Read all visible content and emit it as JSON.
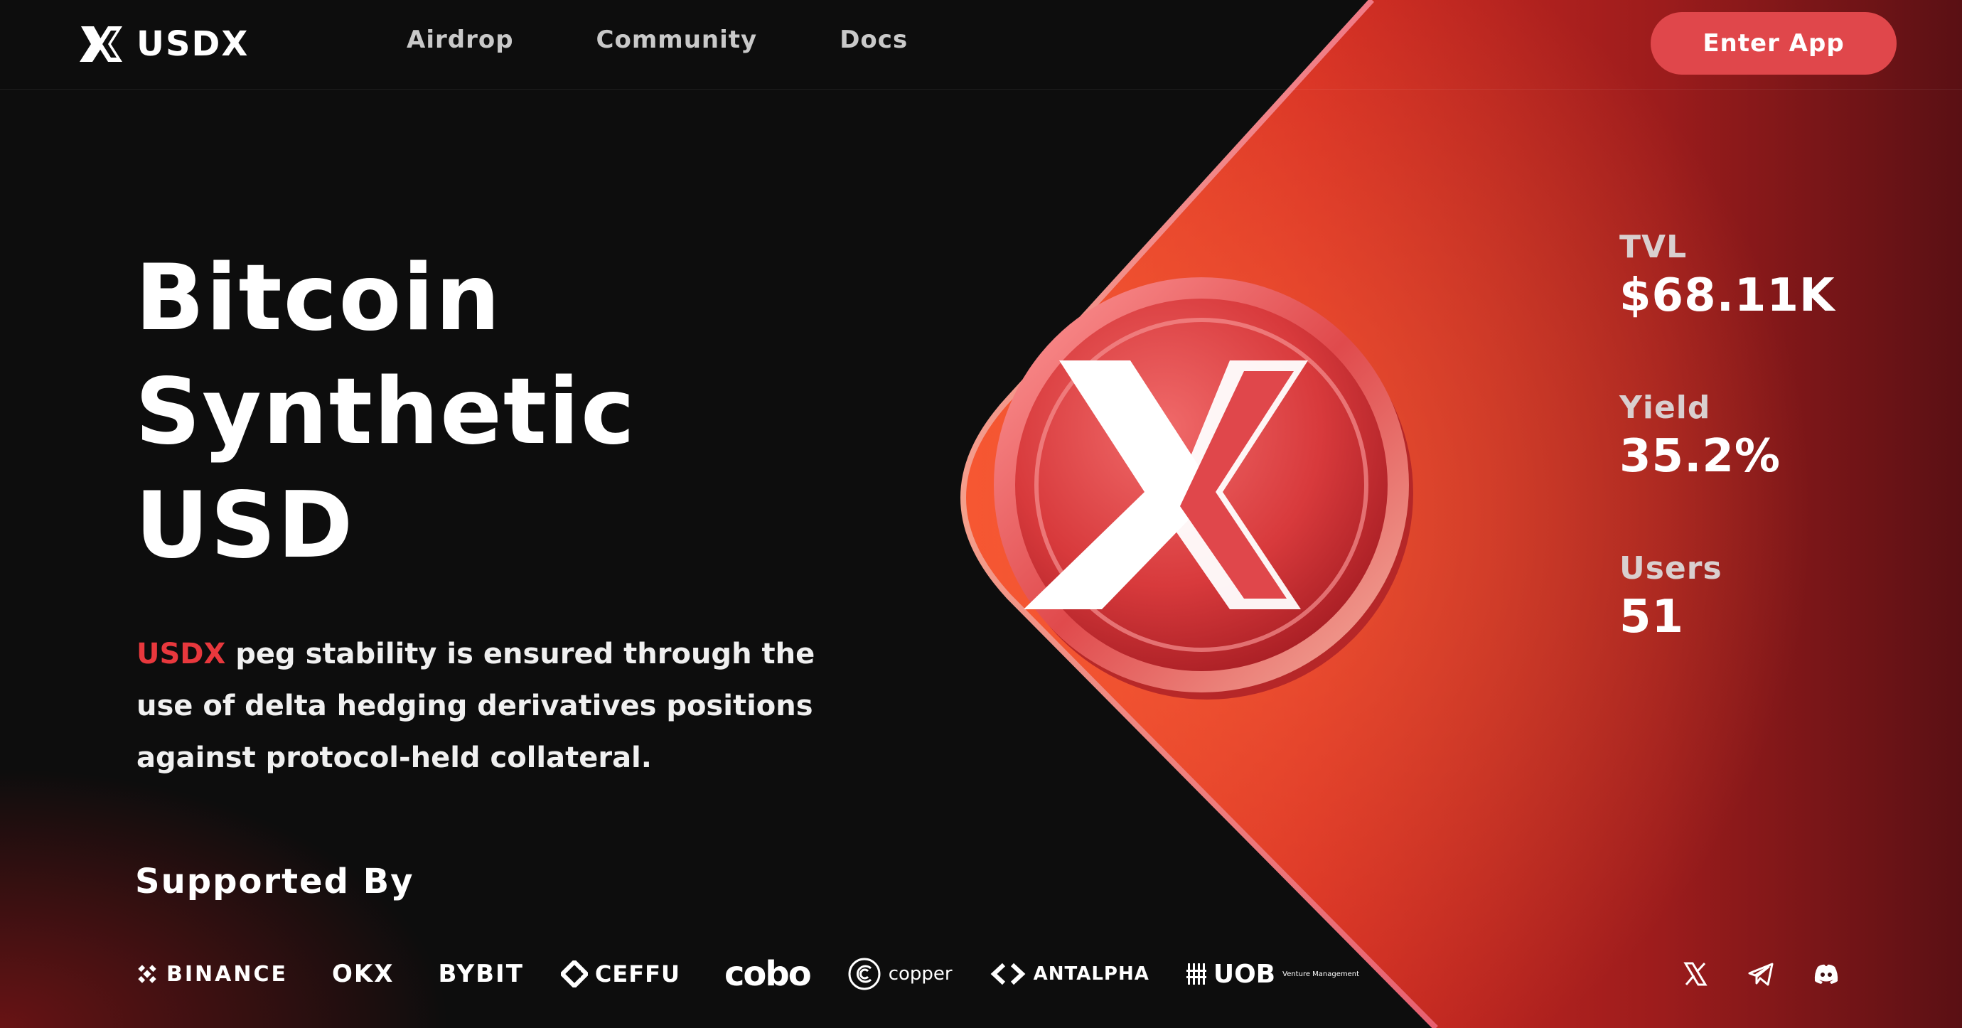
{
  "header": {
    "logo_text": "USDX",
    "nav": [
      {
        "label": "Airdrop"
      },
      {
        "label": "Community"
      },
      {
        "label": "Docs"
      }
    ],
    "cta_label": "Enter App"
  },
  "hero": {
    "title_lines": [
      "Bitcoin",
      "Synthetic",
      "USD"
    ],
    "description_accent": "USDX",
    "description_rest": " peg stability is ensured through the use of delta hedging derivatives positions against protocol-held collateral.",
    "supported_heading": "Supported By"
  },
  "partners": [
    {
      "name": "BINANCE",
      "icon": "binance-icon"
    },
    {
      "name": "OKX",
      "icon": "okx-icon"
    },
    {
      "name": "BYBIT",
      "icon": "bybit-icon"
    },
    {
      "name": "CEFFU",
      "icon": "ceffu-icon"
    },
    {
      "name": "cobo",
      "icon": "cobo-icon"
    },
    {
      "name": "copper",
      "icon": "copper-icon"
    },
    {
      "name": "ANTALPHA",
      "icon": "antalpha-icon"
    },
    {
      "name": "UOB",
      "sub": "Venture Management",
      "icon": "uob-icon"
    }
  ],
  "stats": [
    {
      "label": "TVL",
      "value": "$68.11K"
    },
    {
      "label": "Yield",
      "value": "35.2%"
    },
    {
      "label": "Users",
      "value": "51"
    }
  ],
  "socials": [
    {
      "icon": "x-twitter-icon"
    },
    {
      "icon": "telegram-icon"
    },
    {
      "icon": "discord-icon"
    }
  ],
  "colors": {
    "accent": "#e0474b",
    "accent_text": "#e8383d",
    "background": "#0d0d0d"
  }
}
